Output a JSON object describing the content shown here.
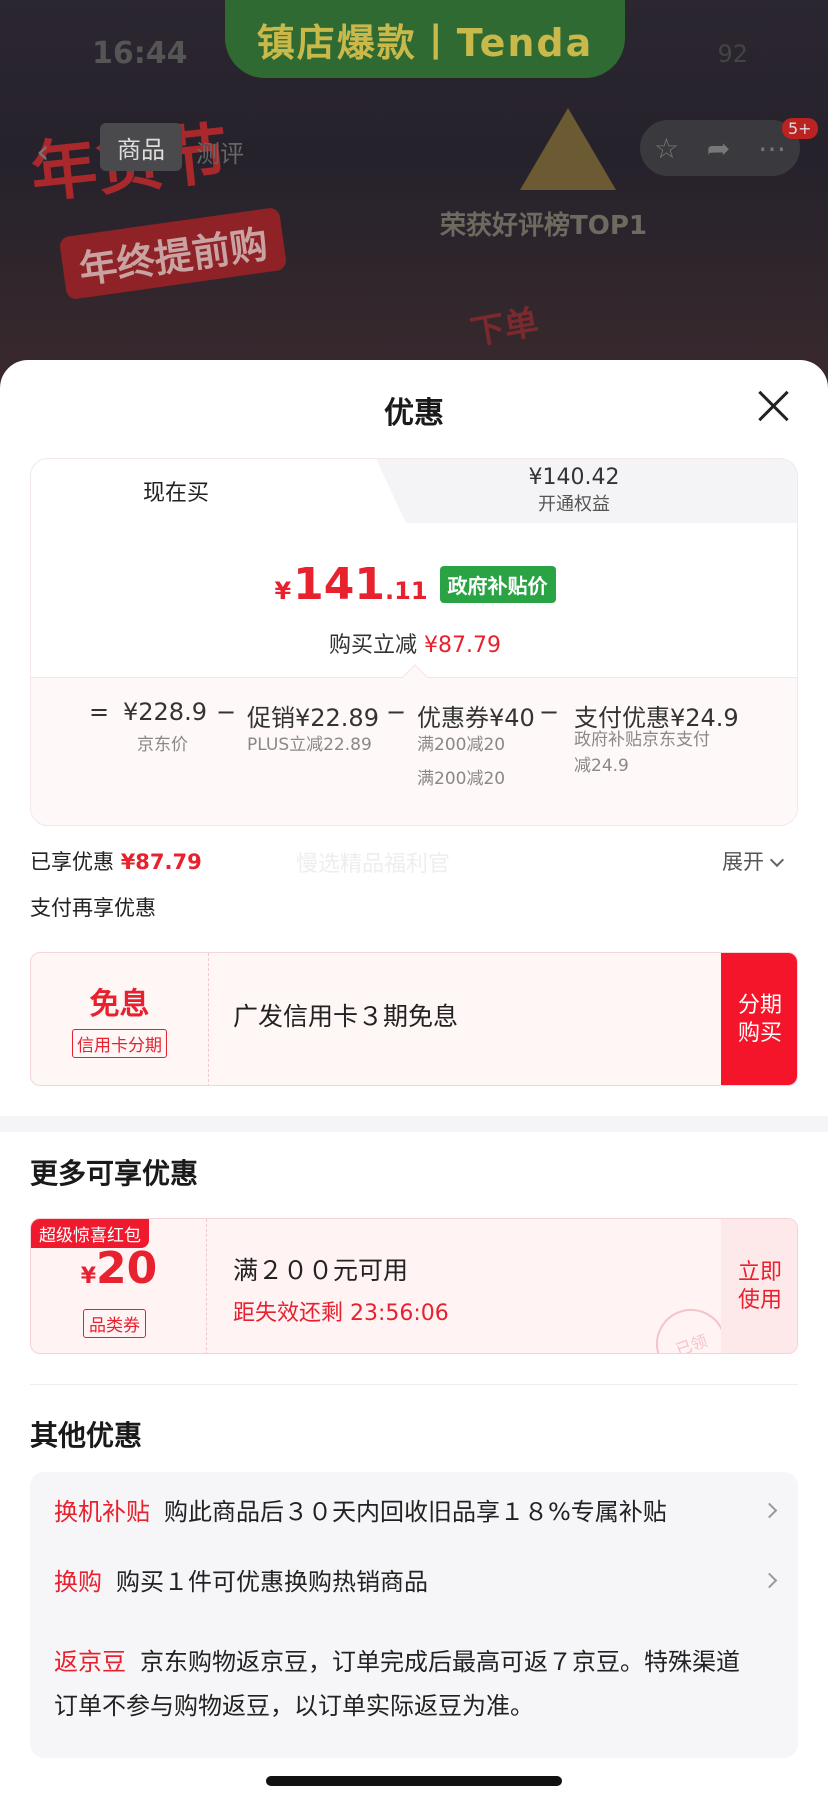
{
  "background": {
    "banner": "镇店爆款丨Tenda",
    "status_time": "16:44",
    "battery": "92",
    "nav": {
      "tab_product": "商品",
      "tab_review": "测评",
      "badge": "5+"
    },
    "promo_1": "年货节",
    "promo_2": "年终提前购",
    "promo_3": "荣获好评榜TOP1",
    "promo_4": "下单"
  },
  "sheet": {
    "title": "优惠",
    "tabs": {
      "buy_now": "现在买",
      "open_price": "¥140.42",
      "open_label": "开通权益"
    },
    "price": {
      "currency": "¥",
      "integer": "141",
      "decimal": ".11",
      "tag": "政府补贴价"
    },
    "discount": {
      "label": "购买立减",
      "amount": "¥87.79"
    },
    "breakdown": {
      "eq": "=",
      "jd_price": "¥228.9",
      "jd_label": "京东价",
      "minus": "−",
      "promo": "促销¥22.89",
      "promo_sub": "PLUS立减22.89",
      "coupon": "优惠券¥40",
      "coupon_sub_1": "满200减20",
      "coupon_sub_2": "满200减20",
      "pay": "支付优惠¥24.9",
      "pay_sub_1": "政府补贴京东支付",
      "pay_sub_2": "减24.9"
    },
    "enjoyed": {
      "label": "已享优惠",
      "amount": "¥87.79",
      "watermark": "慢选精品福利官",
      "expand": "展开"
    },
    "pay_more_title": "支付再享优惠",
    "installment": {
      "big": "免息",
      "tag": "信用卡分期",
      "text": "广发信用卡３期免息",
      "button_1": "分期",
      "button_2": "购买"
    },
    "more_title": "更多可享优惠",
    "coupon": {
      "flag": "超级惊喜红包",
      "currency": "¥",
      "amount": "20",
      "type": "品类券",
      "condition": "满２００元可用",
      "timer": "距失效还剩 23:56:06",
      "button_1": "立即",
      "button_2": "使用",
      "stamp": "已领"
    },
    "other_title": "其他优惠",
    "other": [
      {
        "tag": "换机补贴",
        "text": "购此商品后３０天内回收旧品享１８%专属补贴"
      },
      {
        "tag": "换购",
        "text": "购买１件可优惠换购热销商品"
      },
      {
        "tag": "返京豆",
        "text": "京东购物返京豆，订单完成后最高可返７京豆。特殊渠道订单不参与购物返豆，以订单实际返豆为准。"
      }
    ]
  }
}
